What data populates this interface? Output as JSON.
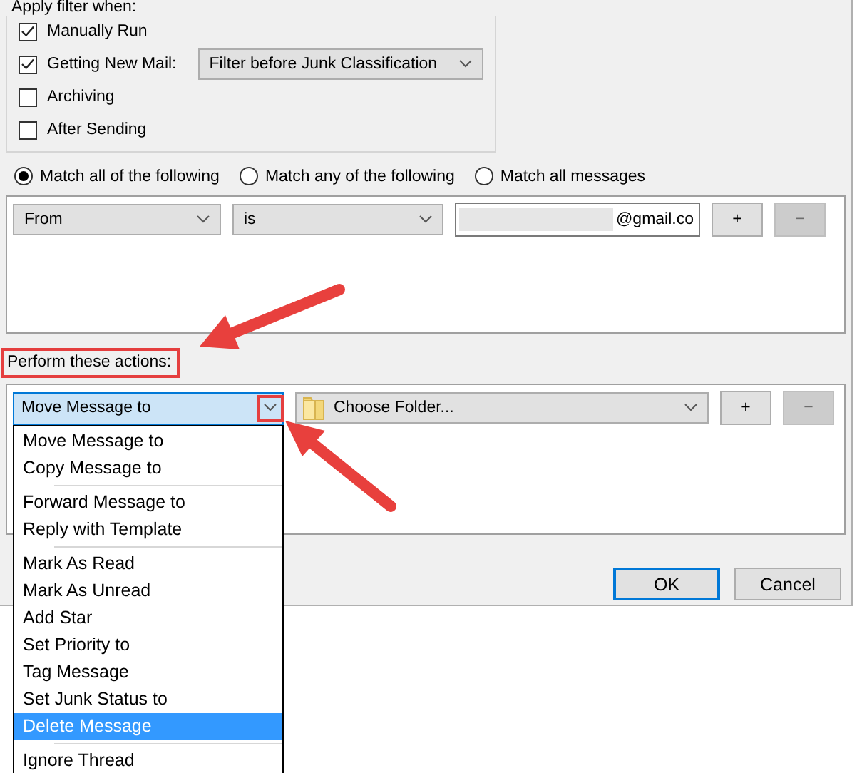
{
  "filter_when": {
    "label": "Apply filter when:",
    "options": [
      {
        "label": "Manually Run",
        "checked": true
      },
      {
        "label": "Getting New Mail:",
        "checked": true,
        "dropdown": "Filter before Junk Classification"
      },
      {
        "label": "Archiving",
        "checked": false
      },
      {
        "label": "After Sending",
        "checked": false
      }
    ]
  },
  "match_options": [
    {
      "label": "Match all of the following",
      "selected": true
    },
    {
      "label": "Match any of the following",
      "selected": false
    },
    {
      "label": "Match all messages",
      "selected": false
    }
  ],
  "conditions": [
    {
      "field": "From",
      "operator": "is",
      "value": "@gmail.co",
      "buttons": [
        {
          "label": "+",
          "disabled": false
        },
        {
          "label": "−",
          "disabled": true
        }
      ]
    }
  ],
  "actions": {
    "label": "Perform these actions:",
    "rows": [
      {
        "action": "Move Message to",
        "target": "Choose Folder...",
        "buttons": [
          {
            "label": "+",
            "disabled": false
          },
          {
            "label": "−",
            "disabled": true
          }
        ]
      }
    ],
    "menu": {
      "groups": [
        [
          {
            "label": "Move Message to",
            "selected": false
          },
          {
            "label": "Copy Message to",
            "selected": false
          }
        ],
        [
          {
            "label": "Forward Message to",
            "selected": false
          },
          {
            "label": "Reply with Template",
            "selected": false
          }
        ],
        [
          {
            "label": "Mark As Read",
            "selected": false
          },
          {
            "label": "Mark As Unread",
            "selected": false
          },
          {
            "label": "Add Star",
            "selected": false
          },
          {
            "label": "Set Priority to",
            "selected": false
          },
          {
            "label": "Tag Message",
            "selected": false
          },
          {
            "label": "Set Junk Status to",
            "selected": false
          },
          {
            "label": "Delete Message",
            "selected": true
          }
        ],
        [
          {
            "label": "Ignore Thread",
            "selected": false
          }
        ]
      ]
    }
  },
  "footer": {
    "buttons": [
      {
        "label": "OK",
        "default": true
      },
      {
        "label": "Cancel",
        "default": false
      }
    ]
  }
}
